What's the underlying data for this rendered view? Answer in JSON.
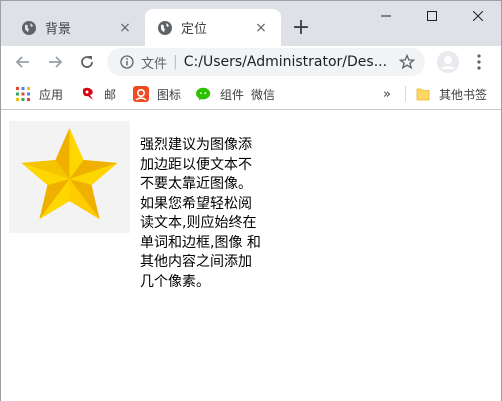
{
  "tabs": [
    {
      "title": "背景",
      "close": "×",
      "active": false
    },
    {
      "title": "定位",
      "close": "×",
      "active": true
    }
  ],
  "new_tab": "+",
  "toolbar": {
    "url_scheme": "文件",
    "url": "C:/Users/Administrator/Des..."
  },
  "bookmarks": {
    "items": [
      {
        "label": "应用",
        "icon": "apps-grid-icon"
      },
      {
        "label": "邮",
        "icon": "netease-mail-icon"
      },
      {
        "label": "图标",
        "icon": "iconfont-icon"
      },
      {
        "label": "组件",
        "icon": "wechat-icon"
      },
      {
        "label": "微信",
        "icon": ""
      }
    ],
    "more": "»",
    "other_folder": "其他书签"
  },
  "page": {
    "paragraph": "强烈建议为图像添加边距以便文本不 不要太靠近图像。如果您希望轻松阅读文本,则应始终在单词和边框,图像 和其他内容之间添加几个像素。"
  },
  "colors": {
    "tabstrip": "#dee1e6",
    "star_light": "#ffd700",
    "star_dark": "#f0b400"
  }
}
